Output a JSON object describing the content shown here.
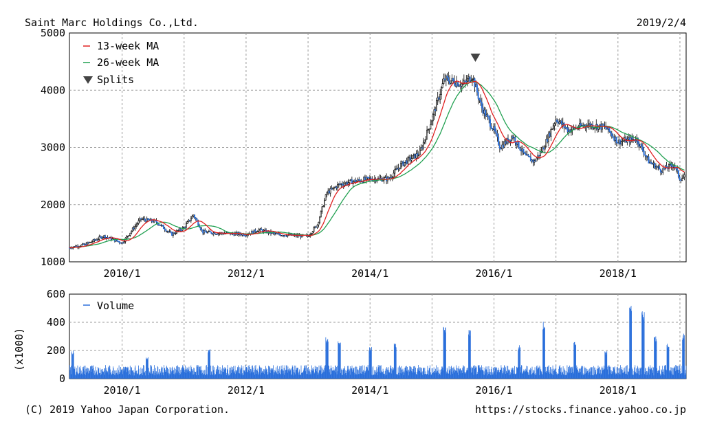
{
  "header": {
    "company": "Saint Marc Holdings Co.,Ltd.",
    "date": "2019/2/4"
  },
  "footer": {
    "copyright": "(C) 2019 Yahoo Japan Corporation.",
    "url": "https://stocks.finance.yahoo.co.jp"
  },
  "colors": {
    "up": "#ffffff",
    "down": "#2a6fdb",
    "ma13": "#e02020",
    "ma26": "#20a050",
    "volume": "#2a6fdb",
    "grid": "#9a9a9a"
  },
  "chart_data": [
    {
      "type": "candlestick",
      "ylim": [
        1000,
        5000
      ],
      "yticks": [
        "1000",
        "2000",
        "3000",
        "4000",
        "5000"
      ],
      "xlim": [
        2009.15,
        2019.1
      ],
      "xticks": [
        {
          "x": 2010.0,
          "label": "2010/1"
        },
        {
          "x": 2012.0,
          "label": "2012/1"
        },
        {
          "x": 2014.0,
          "label": "2014/1"
        },
        {
          "x": 2016.0,
          "label": "2016/1"
        },
        {
          "x": 2018.0,
          "label": "2018/1"
        }
      ],
      "grid": true,
      "legend": {
        "position": "top-left",
        "ma13": "13-week MA",
        "ma26": "26-week MA",
        "splits": "Splits"
      },
      "split_markers": [
        2015.7
      ],
      "price_path": [
        {
          "x": 2009.15,
          "y": 1250
        },
        {
          "x": 2009.4,
          "y": 1300
        },
        {
          "x": 2009.7,
          "y": 1450
        },
        {
          "x": 2010.0,
          "y": 1330
        },
        {
          "x": 2010.3,
          "y": 1750
        },
        {
          "x": 2010.55,
          "y": 1700
        },
        {
          "x": 2010.8,
          "y": 1480
        },
        {
          "x": 2011.0,
          "y": 1600
        },
        {
          "x": 2011.15,
          "y": 1820
        },
        {
          "x": 2011.3,
          "y": 1520
        },
        {
          "x": 2011.6,
          "y": 1500
        },
        {
          "x": 2012.0,
          "y": 1480
        },
        {
          "x": 2012.2,
          "y": 1560
        },
        {
          "x": 2012.5,
          "y": 1480
        },
        {
          "x": 2012.9,
          "y": 1450
        },
        {
          "x": 2013.0,
          "y": 1450
        },
        {
          "x": 2013.15,
          "y": 1650
        },
        {
          "x": 2013.3,
          "y": 2200
        },
        {
          "x": 2013.5,
          "y": 2350
        },
        {
          "x": 2013.7,
          "y": 2400
        },
        {
          "x": 2014.0,
          "y": 2450
        },
        {
          "x": 2014.3,
          "y": 2450
        },
        {
          "x": 2014.5,
          "y": 2700
        },
        {
          "x": 2014.8,
          "y": 2900
        },
        {
          "x": 2015.0,
          "y": 3500
        },
        {
          "x": 2015.2,
          "y": 4200
        },
        {
          "x": 2015.5,
          "y": 4100
        },
        {
          "x": 2015.65,
          "y": 4250
        },
        {
          "x": 2015.8,
          "y": 3700
        },
        {
          "x": 2016.0,
          "y": 3300
        },
        {
          "x": 2016.1,
          "y": 3000
        },
        {
          "x": 2016.3,
          "y": 3200
        },
        {
          "x": 2016.5,
          "y": 2850
        },
        {
          "x": 2016.65,
          "y": 2750
        },
        {
          "x": 2016.8,
          "y": 3000
        },
        {
          "x": 2017.0,
          "y": 3500
        },
        {
          "x": 2017.2,
          "y": 3300
        },
        {
          "x": 2017.5,
          "y": 3400
        },
        {
          "x": 2017.8,
          "y": 3350
        },
        {
          "x": 2018.0,
          "y": 3100
        },
        {
          "x": 2018.3,
          "y": 3150
        },
        {
          "x": 2018.5,
          "y": 2750
        },
        {
          "x": 2018.7,
          "y": 2600
        },
        {
          "x": 2018.9,
          "y": 2700
        },
        {
          "x": 2019.0,
          "y": 2450
        },
        {
          "x": 2019.1,
          "y": 2500
        }
      ]
    },
    {
      "type": "bar",
      "ylim": [
        0,
        600
      ],
      "yticks": [
        "0",
        "200",
        "400",
        "600"
      ],
      "ylabel": "(x1000)",
      "xlim": [
        2009.15,
        2019.1
      ],
      "xticks": [
        {
          "x": 2010.0,
          "label": "2010/1"
        },
        {
          "x": 2012.0,
          "label": "2012/1"
        },
        {
          "x": 2014.0,
          "label": "2014/1"
        },
        {
          "x": 2016.0,
          "label": "2016/1"
        },
        {
          "x": 2018.0,
          "label": "2018/1"
        }
      ],
      "grid": true,
      "legend": {
        "position": "top-left",
        "volume": "Volume"
      },
      "base_level": 75,
      "spikes": [
        {
          "x": 2009.2,
          "y": 200
        },
        {
          "x": 2010.4,
          "y": 160
        },
        {
          "x": 2011.4,
          "y": 210
        },
        {
          "x": 2013.3,
          "y": 300
        },
        {
          "x": 2013.5,
          "y": 270
        },
        {
          "x": 2014.0,
          "y": 230
        },
        {
          "x": 2014.4,
          "y": 260
        },
        {
          "x": 2015.2,
          "y": 380
        },
        {
          "x": 2015.6,
          "y": 350
        },
        {
          "x": 2016.4,
          "y": 240
        },
        {
          "x": 2016.8,
          "y": 410
        },
        {
          "x": 2017.3,
          "y": 260
        },
        {
          "x": 2017.8,
          "y": 200
        },
        {
          "x": 2018.2,
          "y": 560
        },
        {
          "x": 2018.4,
          "y": 490
        },
        {
          "x": 2018.6,
          "y": 300
        },
        {
          "x": 2018.8,
          "y": 250
        },
        {
          "x": 2019.05,
          "y": 320
        }
      ]
    }
  ]
}
